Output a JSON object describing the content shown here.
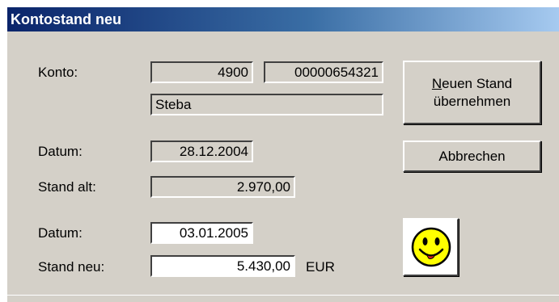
{
  "window": {
    "title": "Kontostand neu"
  },
  "form": {
    "konto_label": "Konto:",
    "konto_number": "4900",
    "konto_account": "00000654321",
    "konto_name": "Steba",
    "datum_old_label": "Datum:",
    "datum_old_value": "28.12.2004",
    "stand_alt_label": "Stand alt:",
    "stand_alt_value": "2.970,00",
    "datum_new_label": "Datum:",
    "datum_new_value": "03.01.2005",
    "stand_neu_label": "Stand neu:",
    "stand_neu_value": "5.430,00",
    "currency": "EUR"
  },
  "buttons": {
    "accept_access_key": "N",
    "accept_line1_rest": "euen Stand",
    "accept_line2": "übernehmen",
    "cancel": "Abbrechen"
  },
  "icons": {
    "status": "smiley-icon"
  },
  "colors": {
    "title_gradient_start": "#0a246a",
    "title_gradient_end": "#a6caf0",
    "dialog_background": "#d4d0c8",
    "smiley_yellow": "#ffff00"
  }
}
